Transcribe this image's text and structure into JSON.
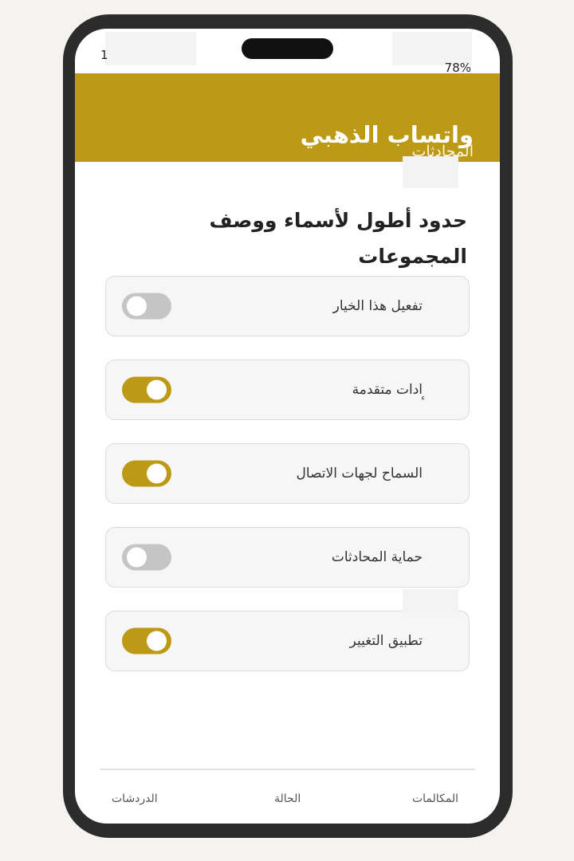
{
  "status_bar": {
    "time": "1",
    "battery": "78%"
  },
  "header": {
    "title": "واتساب الذهبي",
    "subtitle": "المحادثات"
  },
  "section": {
    "title": "حدود أطول لأسماء ووصف المجموعات"
  },
  "options": [
    {
      "label": "تفعيل هذا الخيار",
      "enabled": false
    },
    {
      "label": "ادات متقدمة",
      "enabled": true,
      "mark": "ء"
    },
    {
      "label": "السماح لجهات الاتصال",
      "enabled": true
    },
    {
      "label": "حماية المحادثات",
      "enabled": false
    },
    {
      "label": "تطبيق التغيير",
      "enabled": true
    }
  ],
  "bottom_nav": {
    "calls": "المكالمات",
    "status": "الحالة",
    "chats": "الدردشات"
  },
  "colors": {
    "accent": "#bd9a16",
    "toggle_off": "#c5c5c5",
    "frame": "#2c2c2c"
  }
}
